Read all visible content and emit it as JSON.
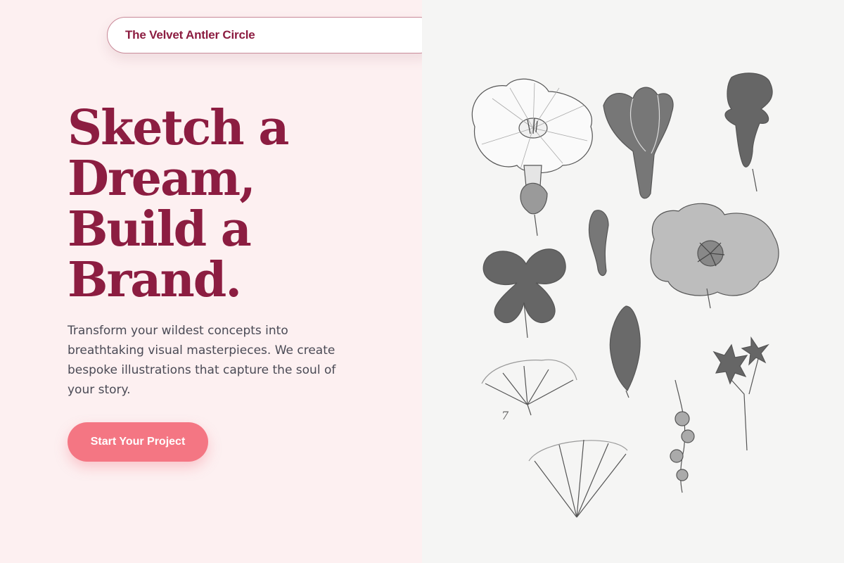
{
  "header": {
    "brand": "The Velvet Antler Circle"
  },
  "hero": {
    "title_lines": [
      "Sketch a",
      "Dream,",
      "Build a",
      "Brand."
    ],
    "description": "Transform your wildest concepts into breathtaking visual masterpieces. We create bespoke illustrations that capture the soul of your story.",
    "cta_label": "Start Your Project"
  },
  "illustration": {
    "plate_number": "7",
    "subject": "botanical-engraving-flowers"
  },
  "colors": {
    "background": "#fdf0f1",
    "accent": "#8c1d41",
    "button": "#f47683",
    "body_text": "#4a4a55"
  }
}
